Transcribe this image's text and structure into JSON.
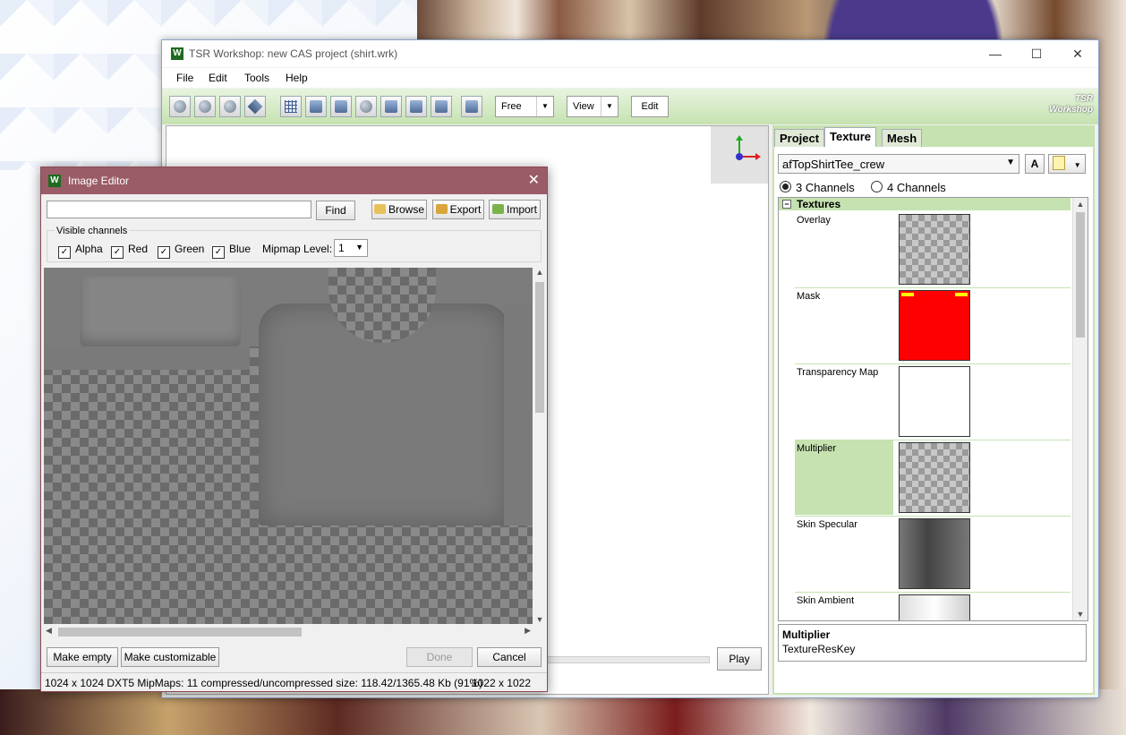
{
  "main_window": {
    "title": "TSR Workshop: new CAS project (shirt.wrk)",
    "controls": {
      "minimize": "—",
      "maximize": "☐",
      "close": "✕"
    },
    "menu": [
      "File",
      "Edit",
      "Tools",
      "Help"
    ],
    "toolbar": {
      "camera_mode": "Free",
      "view_label": "View",
      "edit_label": "Edit",
      "logo_text": "TSR Workshop"
    },
    "play_label": "Play",
    "right_panel": {
      "tabs": [
        "Project",
        "Texture",
        "Mesh"
      ],
      "active_tab": "Texture",
      "texture_select": "afTopShirtTee_crew",
      "a_button": "A",
      "channels": {
        "option1": "3 Channels",
        "option2": "4 Channels",
        "selected": "3 Channels"
      },
      "textures_header": "Textures",
      "textures": [
        {
          "name": "Overlay",
          "thumb": "checker"
        },
        {
          "name": "Mask",
          "thumb": "mask"
        },
        {
          "name": "Transparency Map",
          "thumb": "white"
        },
        {
          "name": "Multiplier",
          "thumb": "checker",
          "selected": true
        },
        {
          "name": "Skin Specular",
          "thumb": "spec"
        },
        {
          "name": "Skin Ambient",
          "thumb": "amb"
        }
      ],
      "info": {
        "title": "Multiplier",
        "value": "TextureResKey"
      }
    }
  },
  "image_editor": {
    "title": "Image Editor",
    "close": "✕",
    "search_value": "",
    "find_label": "Find",
    "browse_label": "Browse",
    "export_label": "Export",
    "import_label": "Import",
    "visible_channels_label": "Visible channels",
    "channels": [
      {
        "label": "Alpha",
        "checked": true
      },
      {
        "label": "Red",
        "checked": true
      },
      {
        "label": "Green",
        "checked": true
      },
      {
        "label": "Blue",
        "checked": true
      }
    ],
    "mipmap_label": "Mipmap Level:",
    "mipmap_value": "1",
    "make_empty_label": "Make empty",
    "make_customizable_label": "Make customizable",
    "done_label": "Done",
    "cancel_label": "Cancel",
    "status_left": "1024 x 1024 DXT5 MipMaps: 11 compressed/uncompressed size: 118.42/1365.48 Kb (91%)",
    "status_right": "1022 x 1022"
  },
  "colors": {
    "toolbar_green": "#c5e2b0",
    "dialog_title": "#9a5c67",
    "mask_red": "#ff0000"
  }
}
